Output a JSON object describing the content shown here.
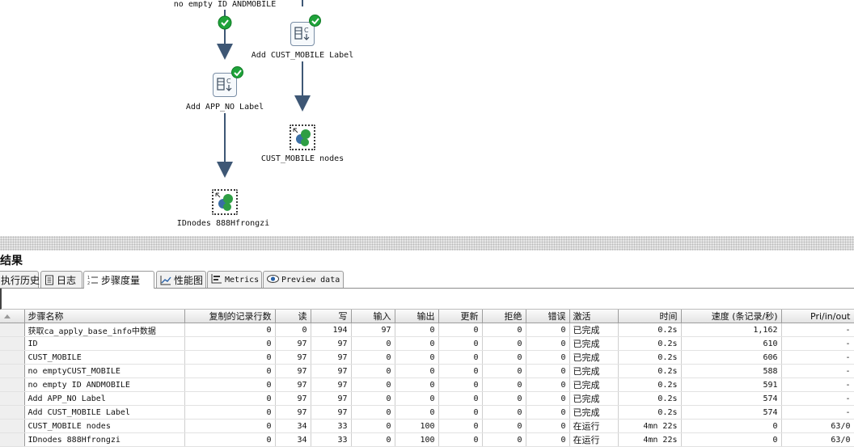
{
  "canvas": {
    "steps": [
      {
        "id": "no-empty-id-andmobile",
        "label": "no empty ID ANDMOBILE"
      },
      {
        "id": "add-cust-mobile-label",
        "label": "Add CUST_MOBILE Label"
      },
      {
        "id": "add-app-no-label",
        "label": "Add APP_NO Label"
      },
      {
        "id": "cust-mobile-nodes",
        "label": "CUST_MOBILE nodes"
      },
      {
        "id": "idnodes-888hfrongzi",
        "label": "IDnodes 888Hfrongzi"
      }
    ],
    "icon_colors": {
      "ok": "#1fa33a",
      "node_green": "#2e9e44",
      "node_blue": "#3a6ea5",
      "hop": "#3e5775"
    }
  },
  "results": {
    "title": "行结果",
    "tabs": [
      {
        "label": "执行历史",
        "icon": "history-icon"
      },
      {
        "label": "日志",
        "icon": "log-icon"
      },
      {
        "label": "步骤度量",
        "icon": "step-metrics-icon",
        "active": true
      },
      {
        "label": "性能图",
        "icon": "performance-chart-icon"
      },
      {
        "label": "Metrics",
        "icon": "metrics-icon"
      },
      {
        "label": "Preview data",
        "icon": "preview-eye-icon"
      }
    ],
    "columns": [
      "",
      "步骤名称",
      "复制的记录行数",
      "读",
      "写",
      "输入",
      "输出",
      "更新",
      "拒绝",
      "错误",
      "激活",
      "时间",
      "速度 (条记录/秒)",
      "Pri/in/out"
    ],
    "rows": [
      {
        "name": "获取ca_apply_base_info中数据",
        "copies": "0",
        "read": "0",
        "written": "194",
        "input": "97",
        "output": "0",
        "updated": "0",
        "rejected": "0",
        "errors": "0",
        "active": "已完成",
        "time": "0.2s",
        "speed": "1,162",
        "pri": "-"
      },
      {
        "name": "ID",
        "copies": "0",
        "read": "97",
        "written": "97",
        "input": "0",
        "output": "0",
        "updated": "0",
        "rejected": "0",
        "errors": "0",
        "active": "已完成",
        "time": "0.2s",
        "speed": "610",
        "pri": "-"
      },
      {
        "name": "CUST_MOBILE",
        "copies": "0",
        "read": "97",
        "written": "97",
        "input": "0",
        "output": "0",
        "updated": "0",
        "rejected": "0",
        "errors": "0",
        "active": "已完成",
        "time": "0.2s",
        "speed": "606",
        "pri": "-"
      },
      {
        "name": "no emptyCUST_MOBILE",
        "copies": "0",
        "read": "97",
        "written": "97",
        "input": "0",
        "output": "0",
        "updated": "0",
        "rejected": "0",
        "errors": "0",
        "active": "已完成",
        "time": "0.2s",
        "speed": "588",
        "pri": "-"
      },
      {
        "name": "no empty ID ANDMOBILE",
        "copies": "0",
        "read": "97",
        "written": "97",
        "input": "0",
        "output": "0",
        "updated": "0",
        "rejected": "0",
        "errors": "0",
        "active": "已完成",
        "time": "0.2s",
        "speed": "591",
        "pri": "-"
      },
      {
        "name": "Add APP_NO Label",
        "copies": "0",
        "read": "97",
        "written": "97",
        "input": "0",
        "output": "0",
        "updated": "0",
        "rejected": "0",
        "errors": "0",
        "active": "已完成",
        "time": "0.2s",
        "speed": "574",
        "pri": "-"
      },
      {
        "name": "Add CUST_MOBILE Label",
        "copies": "0",
        "read": "97",
        "written": "97",
        "input": "0",
        "output": "0",
        "updated": "0",
        "rejected": "0",
        "errors": "0",
        "active": "已完成",
        "time": "0.2s",
        "speed": "574",
        "pri": "-"
      },
      {
        "name": "CUST_MOBILE nodes",
        "copies": "0",
        "read": "34",
        "written": "33",
        "input": "0",
        "output": "100",
        "updated": "0",
        "rejected": "0",
        "errors": "0",
        "active": "在运行",
        "time": "4mn 22s",
        "speed": "0",
        "pri": "63/0"
      },
      {
        "name": "IDnodes 888Hfrongzi",
        "copies": "0",
        "read": "34",
        "written": "33",
        "input": "0",
        "output": "100",
        "updated": "0",
        "rejected": "0",
        "errors": "0",
        "active": "在运行",
        "time": "4mn 22s",
        "speed": "0",
        "pri": "63/0"
      }
    ]
  }
}
